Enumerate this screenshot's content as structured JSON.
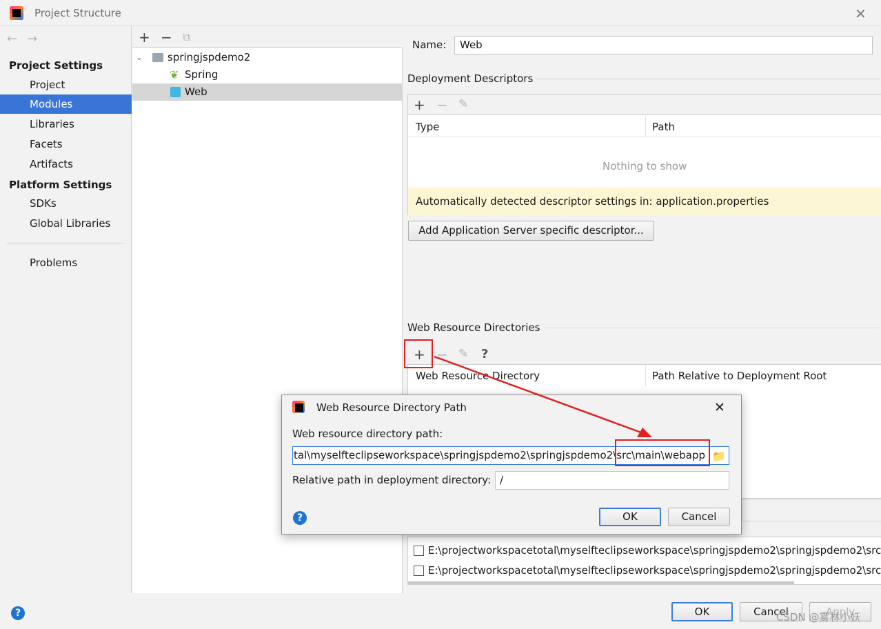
{
  "window": {
    "title": "Project Structure"
  },
  "nav": {
    "project_settings_header": "Project Settings",
    "platform_settings_header": "Platform Settings",
    "items": [
      {
        "label": "Project"
      },
      {
        "label": "Modules"
      },
      {
        "label": "Libraries"
      },
      {
        "label": "Facets"
      },
      {
        "label": "Artifacts"
      }
    ],
    "platform_items": [
      {
        "label": "SDKs"
      },
      {
        "label": "Global Libraries"
      }
    ],
    "problems": "Problems",
    "selected": "Modules"
  },
  "tree": {
    "root": "springjspdemo2",
    "children": [
      "Spring",
      "Web"
    ],
    "selected": "Web"
  },
  "facet": {
    "name_label": "Name:",
    "name_value": "Web",
    "deployment_descriptors": "Deployment Descriptors",
    "col_type": "Type",
    "col_path": "Path",
    "empty_text": "Nothing to show",
    "warning": "Automatically detected descriptor settings in: application.properties",
    "add_descriptor_button": "Add Application Server specific descriptor...",
    "web_resource_dirs": "Web Resource Directories",
    "col_web_dir": "Web Resource Directory",
    "col_rel_path": "Path Relative to Deployment Root",
    "source_roots": [
      "E:\\projectworkspacetotal\\myselfteclipseworkspace\\springjspdemo2\\springjspdemo2\\src\\main\\java",
      "E:\\projectworkspacetotal\\myselfteclipseworkspace\\springjspdemo2\\springjspdemo2\\src\\main\\resources"
    ]
  },
  "dialog": {
    "title": "Web Resource Directory Path",
    "path_label": "Web resource directory path:",
    "path_value": "\\projectworkspacetotal\\myselfteclipseworkspace\\springjspdemo2\\springjspdemo2\\src\\main\\webapp",
    "rel_label": "Relative path in deployment directory:",
    "rel_value": "/",
    "ok": "OK",
    "cancel": "Cancel"
  },
  "footer": {
    "ok": "OK",
    "cancel": "Cancel",
    "apply": "Apply"
  },
  "watermark": "CSDN @雾林小妖",
  "colors": {
    "selection": "#3875d6",
    "annotation": "#e02020",
    "warning_bg": "#fcf6d4"
  }
}
